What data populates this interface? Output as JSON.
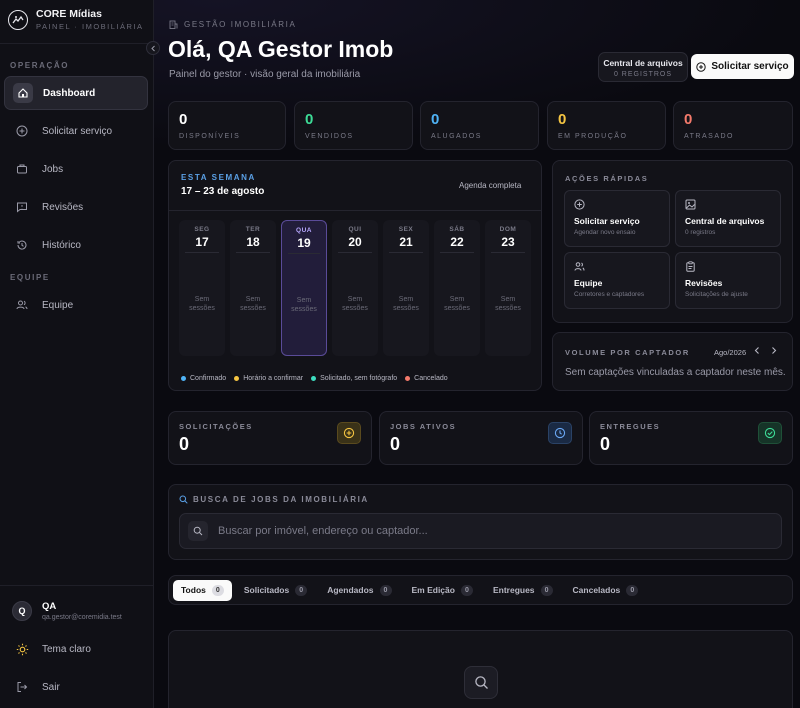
{
  "brand": {
    "name": "CORE Mídias",
    "subtitle": "PAINEL · IMOBILIÁRIA"
  },
  "sidebar": {
    "section_operacao": "OPERAÇÃO",
    "section_equipe": "EQUIPE",
    "items": [
      {
        "label": "Dashboard",
        "icon": "home-icon"
      },
      {
        "label": "Solicitar serviço",
        "icon": "plus-circle-icon"
      },
      {
        "label": "Jobs",
        "icon": "briefcase-icon"
      },
      {
        "label": "Revisões",
        "icon": "message-icon"
      },
      {
        "label": "Histórico",
        "icon": "history-icon"
      },
      {
        "label": "Equipe",
        "icon": "users-icon"
      }
    ],
    "user": {
      "initial": "Q",
      "name": "QA",
      "email": "qa.gestor@coremidia.test"
    },
    "theme_label": "Tema claro",
    "logout_label": "Sair"
  },
  "header": {
    "breadcrumb": "GESTÃO IMOBILIÁRIA",
    "title": "Olá, QA Gestor Imob",
    "subtitle": "Painel do gestor · visão geral da imobiliária",
    "files_button": {
      "label": "Central de arquivos",
      "count": "0 REGISTROS"
    },
    "solicit_button": "Solicitar serviço"
  },
  "stats": [
    {
      "value": "0",
      "label": "DISPONÍVEIS",
      "color": "#ffffff"
    },
    {
      "value": "0",
      "label": "VENDIDOS",
      "color": "#3ddc97"
    },
    {
      "value": "0",
      "label": "ALUGADOS",
      "color": "#4fb3f6"
    },
    {
      "value": "0",
      "label": "EM PRODUÇÃO",
      "color": "#f5c542"
    },
    {
      "value": "0",
      "label": "ATRASADO",
      "color": "#f47a6b"
    }
  ],
  "week": {
    "label": "ESTA SEMANA",
    "range": "17 – 23 de agosto",
    "agenda_link": "Agenda completa",
    "empty_line1": "Sem",
    "empty_line2": "sessões",
    "days": [
      {
        "name": "SEG",
        "num": "17"
      },
      {
        "name": "TER",
        "num": "18"
      },
      {
        "name": "QUA",
        "num": "19"
      },
      {
        "name": "QUI",
        "num": "20"
      },
      {
        "name": "SEX",
        "num": "21"
      },
      {
        "name": "SÁB",
        "num": "22"
      },
      {
        "name": "DOM",
        "num": "23"
      }
    ],
    "legend": [
      {
        "label": "Confirmado",
        "color": "#4fb3f6"
      },
      {
        "label": "Horário a confirmar",
        "color": "#f5c542"
      },
      {
        "label": "Solicitado, sem fotógrafo",
        "color": "#3ddcc0"
      },
      {
        "label": "Cancelado",
        "color": "#f47a6b"
      }
    ]
  },
  "quick_actions": {
    "title": "AÇÕES RÁPIDAS",
    "items": [
      {
        "title": "Solicitar serviço",
        "subtitle": "Agendar novo ensaio",
        "icon": "plus-circle-icon"
      },
      {
        "title": "Central de arquivos",
        "subtitle": "0 registros",
        "icon": "image-icon"
      },
      {
        "title": "Equipe",
        "subtitle": "Corretores e captadores",
        "icon": "users-icon"
      },
      {
        "title": "Revisões",
        "subtitle": "Solicitações de ajuste",
        "icon": "clipboard-icon"
      }
    ]
  },
  "volume": {
    "title": "VOLUME POR CAPTADOR",
    "month": "Ago/2026",
    "empty": "Sem captações vinculadas a captador neste mês."
  },
  "big_stats": [
    {
      "label": "SOLICITAÇÕES",
      "value": "0",
      "icon": "plus-circle-icon",
      "color": "#f5c542"
    },
    {
      "label": "JOBS ATIVOS",
      "value": "0",
      "icon": "clock-icon",
      "color": "#6aa8f5"
    },
    {
      "label": "ENTREGUES",
      "value": "0",
      "icon": "check-circle-icon",
      "color": "#3ddc97"
    }
  ],
  "search": {
    "title": "BUSCA DE JOBS DA IMOBILIÁRIA",
    "placeholder": "Buscar por imóvel, endereço ou captador..."
  },
  "tabs": [
    {
      "label": "Todos",
      "count": "0"
    },
    {
      "label": "Solicitados",
      "count": "0"
    },
    {
      "label": "Agendados",
      "count": "0"
    },
    {
      "label": "Em Edição",
      "count": "0"
    },
    {
      "label": "Entregues",
      "count": "0"
    },
    {
      "label": "Cancelados",
      "count": "0"
    }
  ]
}
